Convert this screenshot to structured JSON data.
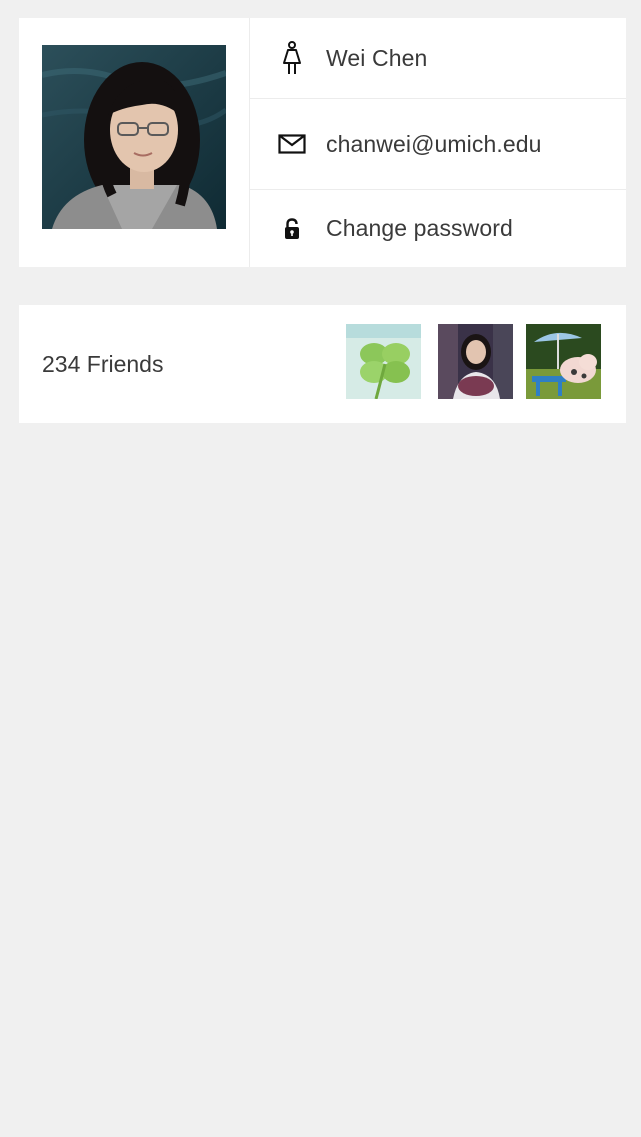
{
  "profile": {
    "name": "Wei Chen",
    "email": "chanwei@umich.edu",
    "password_action": "Change password",
    "avatar_icon": "profile-photo",
    "name_icon": "female-person-icon",
    "email_icon": "envelope-icon",
    "password_icon": "lock-icon"
  },
  "friends": {
    "count_label": "234 Friends",
    "thumbnails": [
      "clover-photo",
      "girl-photo",
      "pig-photo"
    ]
  },
  "colors": {
    "background": "#f0f0f0",
    "card": "#ffffff",
    "divider": "#ececec",
    "text": "#3a3a3a"
  }
}
